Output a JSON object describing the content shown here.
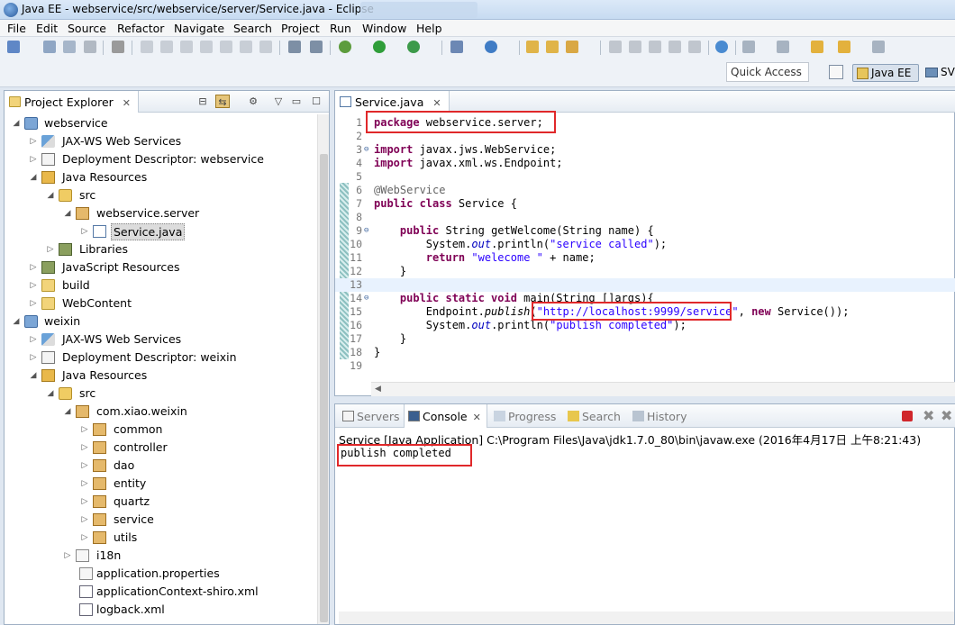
{
  "window": {
    "title": "Java EE - webservice/src/webservice/server/Service.java - Eclipse"
  },
  "menu": [
    "File",
    "Edit",
    "Source",
    "Refactor",
    "Navigate",
    "Search",
    "Project",
    "Run",
    "Window",
    "Help"
  ],
  "toolbar": {
    "quick_access_placeholder": "Quick Access",
    "perspectives": [
      {
        "label": "Java EE",
        "active": true
      },
      {
        "label": "SV",
        "active": false
      }
    ]
  },
  "explorer": {
    "tab_label": "Project Explorer",
    "tree": [
      {
        "label": "webservice",
        "icon": "project-icon",
        "arrow": "expanded"
      },
      {
        "label": "JAX-WS Web Services",
        "icon": "jaxws-icon",
        "arrow": "collapsed"
      },
      {
        "label": "Deployment Descriptor: webservice",
        "icon": "deployment-descriptor-icon",
        "arrow": "collapsed"
      },
      {
        "label": "Java Resources",
        "icon": "java-resources-icon",
        "arrow": "expanded"
      },
      {
        "label": "src",
        "icon": "source-folder-icon",
        "arrow": "expanded"
      },
      {
        "label": "webservice.server",
        "icon": "package-icon",
        "arrow": "expanded"
      },
      {
        "label": "Service.java",
        "icon": "java-file-icon",
        "arrow": "collapsed",
        "selected": true
      },
      {
        "label": "Libraries",
        "icon": "libraries-icon",
        "arrow": "collapsed"
      },
      {
        "label": "JavaScript Resources",
        "icon": "javascript-resources-icon",
        "arrow": "collapsed"
      },
      {
        "label": "build",
        "icon": "folder-icon",
        "arrow": "collapsed"
      },
      {
        "label": "WebContent",
        "icon": "folder-icon",
        "arrow": "collapsed"
      },
      {
        "label": "weixin",
        "icon": "project-icon",
        "arrow": "expanded"
      },
      {
        "label": "JAX-WS Web Services",
        "icon": "jaxws-icon",
        "arrow": "collapsed"
      },
      {
        "label": "Deployment Descriptor: weixin",
        "icon": "deployment-descriptor-icon",
        "arrow": "collapsed"
      },
      {
        "label": "Java Resources",
        "icon": "java-resources-icon",
        "arrow": "expanded"
      },
      {
        "label": "src",
        "icon": "source-folder-icon",
        "arrow": "expanded"
      },
      {
        "label": "com.xiao.weixin",
        "icon": "package-icon",
        "arrow": "expanded"
      },
      {
        "label": "common",
        "icon": "package-icon",
        "arrow": "collapsed"
      },
      {
        "label": "controller",
        "icon": "package-icon",
        "arrow": "collapsed"
      },
      {
        "label": "dao",
        "icon": "package-icon",
        "arrow": "collapsed"
      },
      {
        "label": "entity",
        "icon": "package-icon",
        "arrow": "collapsed"
      },
      {
        "label": "quartz",
        "icon": "package-icon",
        "arrow": "collapsed"
      },
      {
        "label": "service",
        "icon": "package-icon",
        "arrow": "collapsed"
      },
      {
        "label": "utils",
        "icon": "package-icon",
        "arrow": "collapsed"
      },
      {
        "label": "i18n",
        "icon": "package-icon",
        "arrow": "collapsed"
      },
      {
        "label": "application.properties",
        "icon": "properties-file-icon",
        "arrow": "none"
      },
      {
        "label": "applicationContext-shiro.xml",
        "icon": "xml-file-icon",
        "arrow": "none"
      },
      {
        "label": "logback.xml",
        "icon": "xml-file-icon",
        "arrow": "none"
      }
    ]
  },
  "editor": {
    "tab_label": "Service.java",
    "lines": [
      {
        "n": "1",
        "text": "package webservice.server;"
      },
      {
        "n": "2",
        "text": ""
      },
      {
        "n": "3",
        "text": "import javax.jws.WebService;"
      },
      {
        "n": "4",
        "text": "import javax.xml.ws.Endpoint;"
      },
      {
        "n": "5",
        "text": ""
      },
      {
        "n": "6",
        "text": "@WebService"
      },
      {
        "n": "7",
        "text": "public class Service {"
      },
      {
        "n": "8",
        "text": ""
      },
      {
        "n": "9",
        "text": "    public String getWelcome(String name) {"
      },
      {
        "n": "10",
        "text": "        System.out.println(\"service called\");"
      },
      {
        "n": "11",
        "text": "        return \"welecome \" + name;"
      },
      {
        "n": "12",
        "text": "    }"
      },
      {
        "n": "13",
        "text": ""
      },
      {
        "n": "14",
        "text": "    public static void main(String []args){"
      },
      {
        "n": "15",
        "text": "        Endpoint.publish(\"http://localhost:9999/service\", new Service());"
      },
      {
        "n": "16",
        "text": "        System.out.println(\"publish completed\");"
      },
      {
        "n": "17",
        "text": "    }"
      },
      {
        "n": "18",
        "text": "}"
      },
      {
        "n": "19",
        "text": ""
      }
    ]
  },
  "console": {
    "tabs": [
      {
        "label": "Servers",
        "active": false
      },
      {
        "label": "Console",
        "active": true
      },
      {
        "label": "Progress",
        "active": false
      },
      {
        "label": "Search",
        "active": false
      },
      {
        "label": "History",
        "active": false
      }
    ],
    "description": "Service [Java Application] C:\\Program Files\\Java\\jdk1.7.0_80\\bin\\javaw.exe (2016年4月17日 上午8:21:43)",
    "output": "publish completed"
  },
  "colors": {
    "keyword": "#7f0055",
    "string": "#2a00ff",
    "annotation": "#646464",
    "highlight_box": "#e0282a"
  }
}
